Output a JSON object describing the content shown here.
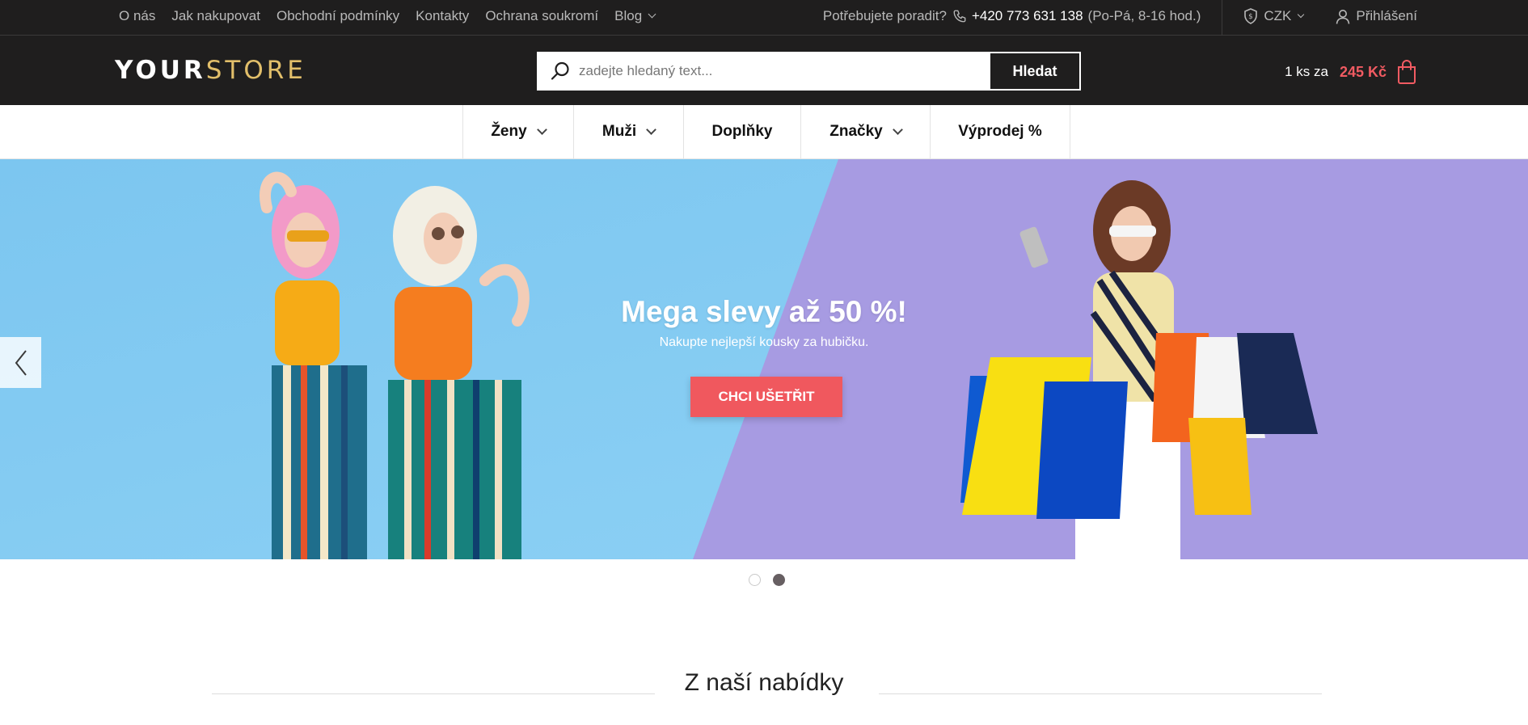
{
  "topbar": {
    "links": [
      {
        "label": "O nás"
      },
      {
        "label": "Jak nakupovat"
      },
      {
        "label": "Obchodní podmínky"
      },
      {
        "label": "Kontakty"
      },
      {
        "label": "Ochrana soukromí"
      },
      {
        "label": "Blog"
      }
    ],
    "help_text": "Potřebujete poradit?",
    "phone": "+420 773 631 138",
    "hours": "(Po-Pá, 8-16 hod.)",
    "currency": "CZK",
    "login": "Přihlášení"
  },
  "header": {
    "logo_part1": "YOUR",
    "logo_part2": "STORE",
    "search_placeholder": "zadejte hledaný text...",
    "search_button": "Hledat",
    "cart_count": "1 ks za",
    "cart_price": "245 Kč"
  },
  "nav": {
    "items": [
      {
        "label": "Ženy"
      },
      {
        "label": "Muži"
      },
      {
        "label": "Doplňky"
      },
      {
        "label": "Značky"
      },
      {
        "label": "Výprodej %"
      }
    ]
  },
  "hero": {
    "title": "Mega slevy až 50 %!",
    "subtitle": "Nakupte nejlepší kousky za hubičku.",
    "button": "CHCI UŠETŘIT",
    "active_slide": 2,
    "slide_count": 2
  },
  "section": {
    "title": "Z naší nabídky"
  },
  "colors": {
    "dark": "#1f1e1e",
    "accent": "#f0585e",
    "logo_gold": "#e2bf6a",
    "hero_blue": "#86c9f0",
    "hero_purple": "#a89be3"
  }
}
